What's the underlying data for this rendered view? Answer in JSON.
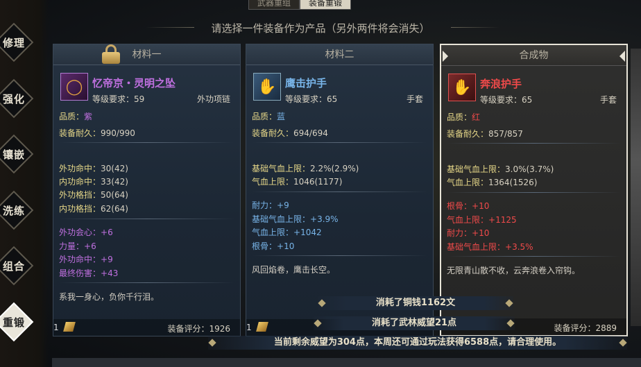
{
  "top_tabs": [
    "武器重组",
    "装备重锻"
  ],
  "subtitle": "请选择一件装备作为产品（另外两件将会消失）",
  "side_menu": [
    "修理",
    "强化",
    "镶嵌",
    "洗练",
    "组合",
    "重锻"
  ],
  "panels": [
    {
      "title": "材料一",
      "item_name": "忆帝京・灵明之坠",
      "level_req": "等级要求：59",
      "item_type": "外功项链",
      "quality_label": "品质：",
      "quality": "紫",
      "durability_label": "装备耐久：",
      "durability": "990/990",
      "base_stats": [
        {
          "name": "外功命中：",
          "value": "30(42)"
        },
        {
          "name": "内功命中：",
          "value": "33(42)"
        },
        {
          "name": "外功格挡：",
          "value": "50(64)"
        },
        {
          "name": "内功格挡：",
          "value": "62(64)"
        }
      ],
      "extra_stats": [
        {
          "name": "外功会心：",
          "value": "+6"
        },
        {
          "name": "力量：",
          "value": "+6"
        },
        {
          "name": "外功命中：",
          "value": "+9"
        },
        {
          "name": "最终伤害：",
          "value": "+43"
        }
      ],
      "flavor": "系我一身心，负你千行泪。",
      "count": "1",
      "score_label": "装备评分：",
      "score": "1926"
    },
    {
      "title": "材料二",
      "item_name": "鹰击护手",
      "level_req": "等级要求：65",
      "item_type": "手套",
      "quality_label": "品质：",
      "quality": "蓝",
      "durability_label": "装备耐久：",
      "durability": "694/694",
      "base_stats": [
        {
          "name": "基础气血上限：",
          "value": "2.2%(2.9%)"
        },
        {
          "name": "气血上限：",
          "value": "1046(1177)"
        }
      ],
      "extra_stats": [
        {
          "name": "耐力：",
          "value": "+9"
        },
        {
          "name": "基础气血上限：",
          "value": "+3.9%"
        },
        {
          "name": "气血上限：",
          "value": "+1042"
        },
        {
          "name": "根骨：",
          "value": "+10"
        }
      ],
      "flavor": "风回焰卷，鹰击长空。",
      "count": "1"
    },
    {
      "title": "合成物",
      "item_name": "奔浪护手",
      "level_req": "等级要求：65",
      "item_type": "手套",
      "quality_label": "品质：",
      "quality": "红",
      "durability_label": "装备耐久：",
      "durability": "857/857",
      "base_stats": [
        {
          "name": "基础气血上限：",
          "value": "3.0%(3.7%)"
        },
        {
          "name": "气血上限：",
          "value": "1364(1526)"
        }
      ],
      "extra_stats": [
        {
          "name": "根骨：",
          "value": "+10"
        },
        {
          "name": "气血上限：",
          "value": "+1125"
        },
        {
          "name": "耐力：",
          "value": "+10"
        },
        {
          "name": "基础气血上限：",
          "value": "+3.5%"
        }
      ],
      "flavor": "无限青山散不收，云奔浪卷入帘钩。",
      "score_label": "装备评分：",
      "score": "2889"
    }
  ],
  "messages": [
    "消耗了铜钱1162文",
    "消耗了武林威望21点",
    "当前剩余威望为304点，本周还可通过玩法获得6588点，请合理使用。"
  ],
  "colors": {
    "purple": "#c070e0",
    "blue": "#78b4e8",
    "red": "#f04a4a",
    "yellow": "#e6d788"
  },
  "icons": [
    "lock-icon",
    "necklace-icon",
    "gauntlet-icon",
    "gold-ingot-icon"
  ]
}
